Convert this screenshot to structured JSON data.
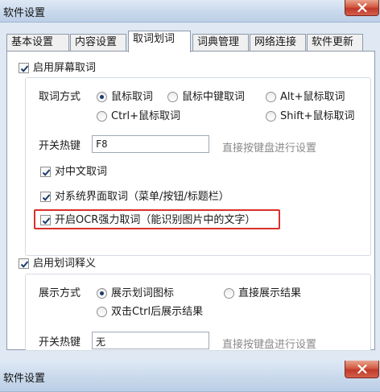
{
  "window": {
    "title": "软件设置",
    "close_icon": "close-icon"
  },
  "tabs": [
    {
      "label": "基本设置",
      "active": false
    },
    {
      "label": "内容设置",
      "active": false
    },
    {
      "label": "取词划词",
      "active": true
    },
    {
      "label": "词典管理",
      "active": false
    },
    {
      "label": "网络连接",
      "active": false
    },
    {
      "label": "软件更新",
      "active": false
    }
  ],
  "screen_capture": {
    "enable_label": "启用屏幕取词",
    "enabled": true,
    "method_label": "取词方式",
    "methods": [
      {
        "label": "鼠标取词",
        "selected": true
      },
      {
        "label": "鼠标中键取词",
        "selected": false
      },
      {
        "label": "Alt+鼠标取词",
        "selected": false
      },
      {
        "label": "Ctrl+鼠标取词",
        "selected": false
      },
      {
        "label": "Shift+鼠标取词",
        "selected": false
      }
    ],
    "hotkey_label": "开关热键",
    "hotkey_value": "F8",
    "hotkey_hint": "直接按键盘进行设置",
    "options": [
      {
        "label": "对中文取词",
        "checked": true
      },
      {
        "label": "对系统界面取词（菜单/按钮/标题栏）",
        "checked": true
      },
      {
        "label": "开启OCR强力取词（能识别图片中的文字）",
        "checked": true
      }
    ]
  },
  "selection_explain": {
    "enable_label": "启用划词释义",
    "enabled": true,
    "display_label": "展示方式",
    "modes": [
      {
        "label": "展示划词图标",
        "selected": true
      },
      {
        "label": "直接展示结果",
        "selected": false
      },
      {
        "label": "双击Ctrl后展示结果",
        "selected": false
      }
    ],
    "hotkey_label": "开关热键",
    "hotkey_value": "无",
    "hotkey_hint": "直接按键盘进行设置"
  },
  "second_window": {
    "title": "软件设置"
  },
  "colors": {
    "highlight": "#d9302a",
    "close_button": "#c0392b"
  }
}
